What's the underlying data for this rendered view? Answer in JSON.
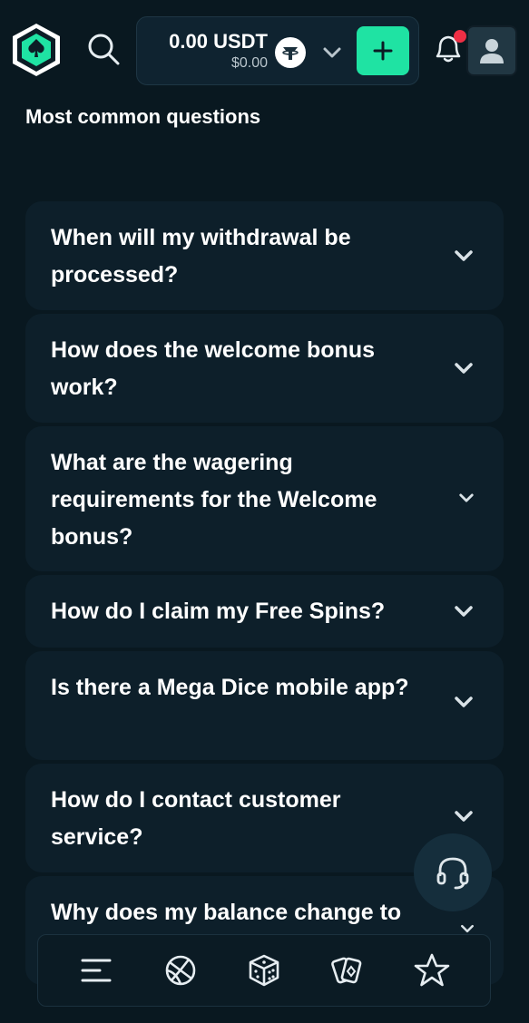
{
  "header": {
    "balance": "0.00 USDT",
    "balance_usd": "$0.00",
    "currency_icon": "tether-icon",
    "deposit_icon": "plus-icon",
    "colors": {
      "accent": "#1fe3a3",
      "notification": "#ef2f45",
      "background": "#091820"
    }
  },
  "faq": {
    "title": "Most common questions",
    "items": [
      {
        "question": "When will my withdrawal be processed?"
      },
      {
        "question": "How does the welcome bonus work?"
      },
      {
        "question": "What are the wagering requirements for the Welcome bonus?"
      },
      {
        "question": "How do I claim my Free Spins?"
      },
      {
        "question": "Is there a Mega Dice mobile app?"
      },
      {
        "question": "How do I contact customer service?"
      },
      {
        "question": "Why does my balance change to"
      }
    ]
  },
  "bottom_nav": {
    "items": [
      {
        "icon": "menu-icon"
      },
      {
        "icon": "sports-ball-icon"
      },
      {
        "icon": "dice-icon"
      },
      {
        "icon": "cards-icon"
      },
      {
        "icon": "star-icon"
      }
    ]
  }
}
